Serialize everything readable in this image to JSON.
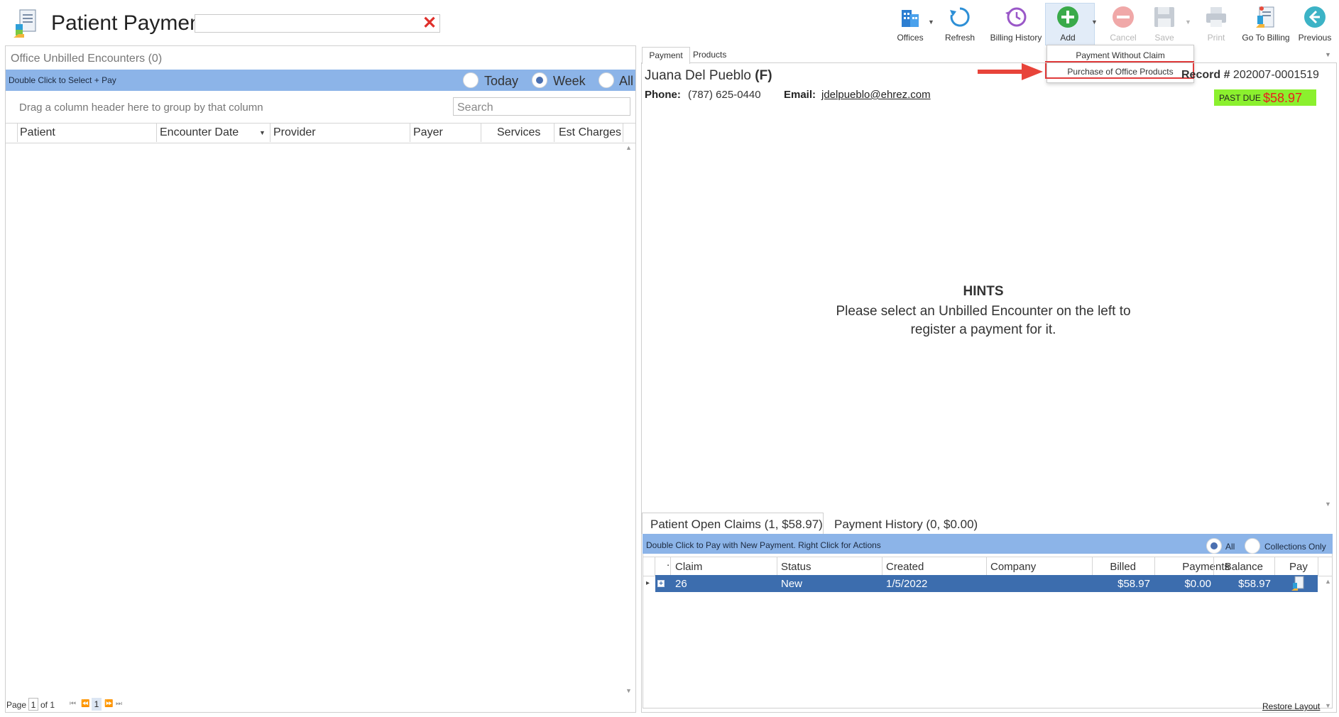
{
  "header": {
    "title": "Patient Payments",
    "search_value": ""
  },
  "toolbar": {
    "offices": "Offices",
    "refresh": "Refresh",
    "billing_history": "Billing History",
    "add": "Add",
    "cancel": "Cancel",
    "save": "Save",
    "print": "Print",
    "go_to_billing": "Go To Billing",
    "previous": "Previous"
  },
  "add_menu": {
    "items": [
      "Payment Without Claim",
      "Purchase of Office Products"
    ],
    "highlighted": "Purchase of Office Products"
  },
  "left": {
    "title": "Office Unbilled Encounters (0)",
    "bar_text": "Double Click to Select + Pay",
    "filters": [
      {
        "label": "Today",
        "selected": false
      },
      {
        "label": "Week",
        "selected": true
      },
      {
        "label": "All",
        "selected": false
      }
    ],
    "group_hint": "Drag a column header here to group by that column",
    "search_placeholder": "Search",
    "columns": [
      "Patient",
      "Encounter Date",
      "Provider",
      "Payer",
      "Services",
      "Est Charges"
    ],
    "pager": {
      "page_label": "Page",
      "page": "1",
      "of": "of 1",
      "nav_page": "1"
    }
  },
  "right": {
    "tabs": [
      "Payment",
      "Products"
    ],
    "patient": {
      "name": "Juana Del Pueblo",
      "sex": "(F)",
      "record_label": "Record #",
      "record": "202007-0001519",
      "phone_label": "Phone:",
      "phone": "(787) 625-0440",
      "email_label": "Email:",
      "email": "jdelpueblo@ehrez.com",
      "past_due_label": "PAST DUE",
      "past_due_amount": "$58.97"
    },
    "hints": {
      "title": "HINTS",
      "text": "Please select an Unbilled Encounter on the left to register a payment for it."
    },
    "bottom_tabs": [
      "Patient Open Claims (1, $58.97)",
      "Payment History (0, $0.00)"
    ],
    "claims_bar_text": "Double Click to Pay with New Payment. Right Click for Actions",
    "claims_filters": [
      {
        "label": "All",
        "selected": true
      },
      {
        "label": "Collections Only",
        "selected": false
      }
    ],
    "claims_columns": [
      ".",
      "Claim",
      "Status",
      "Created",
      "Company",
      "Billed",
      "Payments",
      "Balance",
      "Pay"
    ],
    "claims_rows": [
      {
        "claim": "26",
        "status": "New",
        "created": "1/5/2022",
        "company": "",
        "billed": "$58.97",
        "payments": "$0.00",
        "balance": "$58.97"
      }
    ],
    "restore_layout": "Restore Layout"
  },
  "colors": {
    "blue_bar": "#8cb4e8",
    "selected_row": "#3c6dae",
    "past_due_bg": "#8bf02e",
    "past_due_text": "#e81e1e",
    "highlight_border": "#e03b3b"
  },
  "icons": [
    "app-document-icon",
    "clear-x-icon",
    "offices-building-icon",
    "refresh-icon",
    "billing-history-clock-icon",
    "add-plus-icon",
    "cancel-minus-icon",
    "save-floppy-icon",
    "print-icon",
    "go-to-billing-icon",
    "previous-arrow-icon",
    "pay-icon"
  ]
}
